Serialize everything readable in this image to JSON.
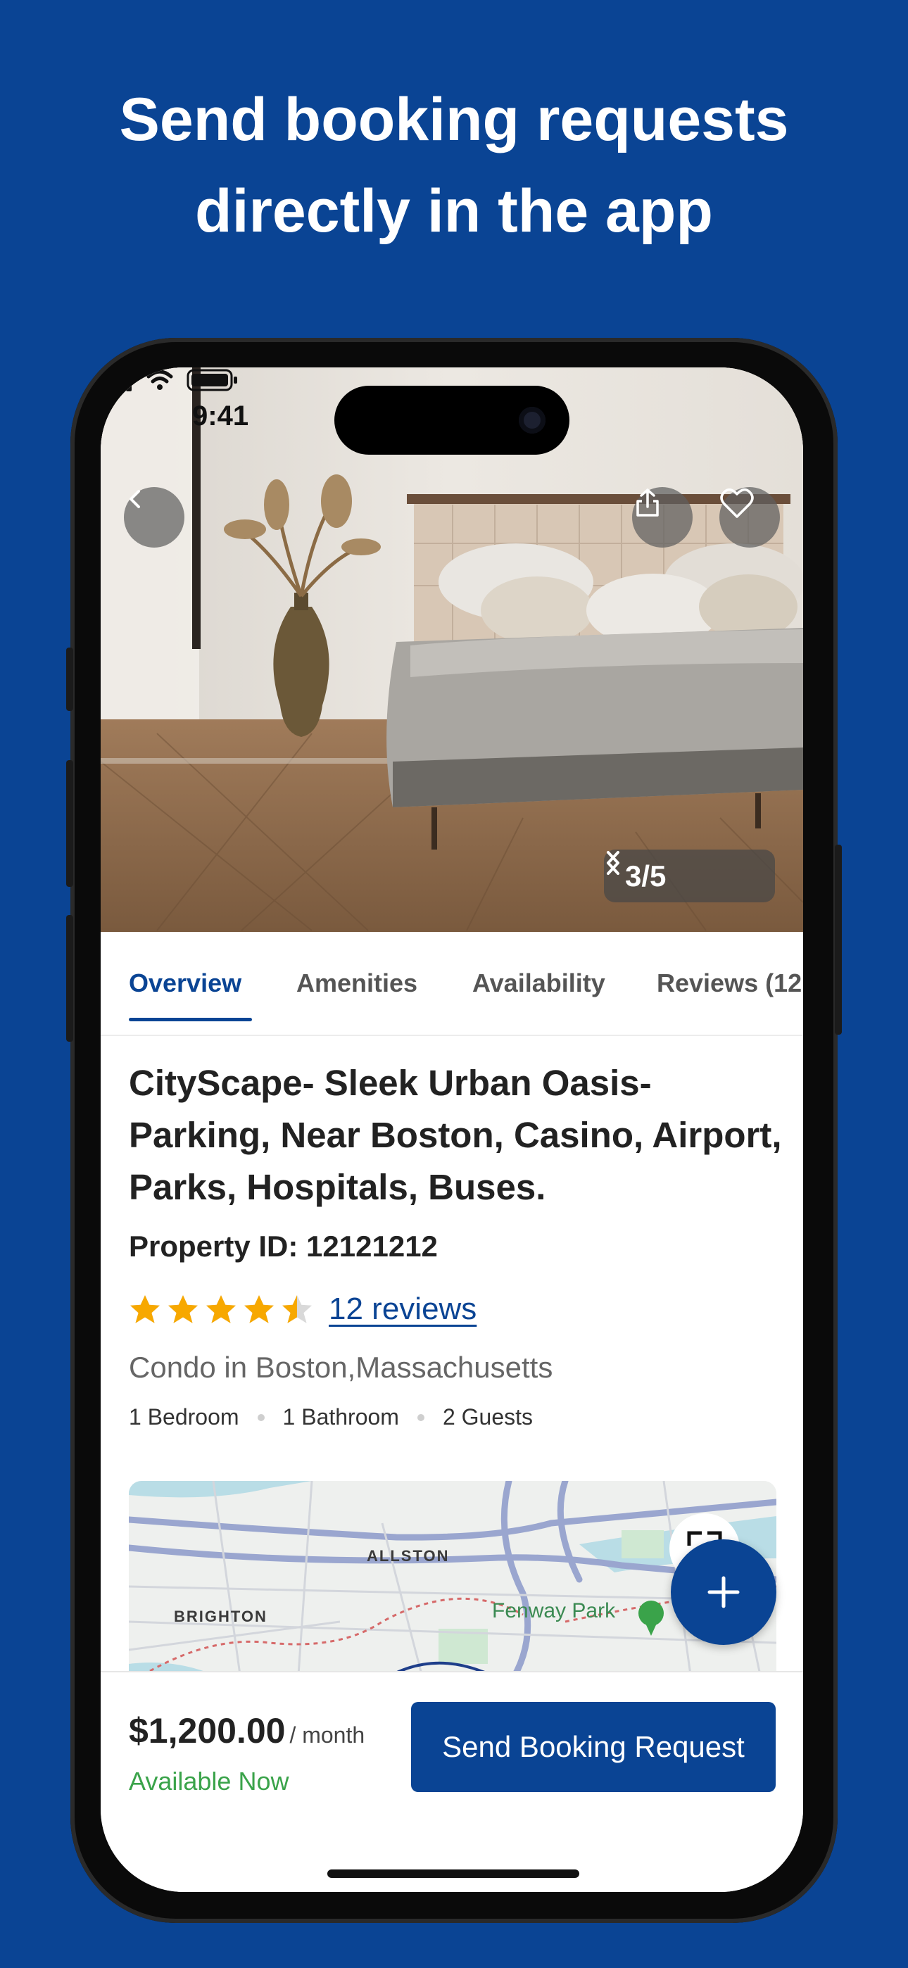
{
  "headline": {
    "line1": "Send booking requests",
    "line2": "directly in the app"
  },
  "status_bar": {
    "time": "9:41"
  },
  "gallery": {
    "counter": "3/5"
  },
  "tabs": [
    "Overview",
    "Amenities",
    "Availability",
    "Reviews (12"
  ],
  "active_tab": "Overview",
  "listing": {
    "title": "CityScape- Sleek Urban Oasis- Parking, Near Boston, Casino, Airport, Parks, Hospitals, Buses.",
    "property_id": "Property ID: 12121212",
    "rating": 4.5,
    "reviews_link": "12 reviews",
    "location": "Condo in Boston,Massachusetts",
    "specs": [
      "1 Bedroom",
      "1 Bathroom",
      "2 Guests"
    ]
  },
  "map": {
    "labels": [
      "ALLSTON",
      "BRIGHTON"
    ],
    "poi": "Fenway Park"
  },
  "footer": {
    "price": "$1,200.00",
    "price_unit": "/ month",
    "availability": "Available Now",
    "cta": "Send Booking Request"
  },
  "colors": {
    "brand": "#0a4494",
    "available": "#3aa34a",
    "star": "#f7a800"
  }
}
